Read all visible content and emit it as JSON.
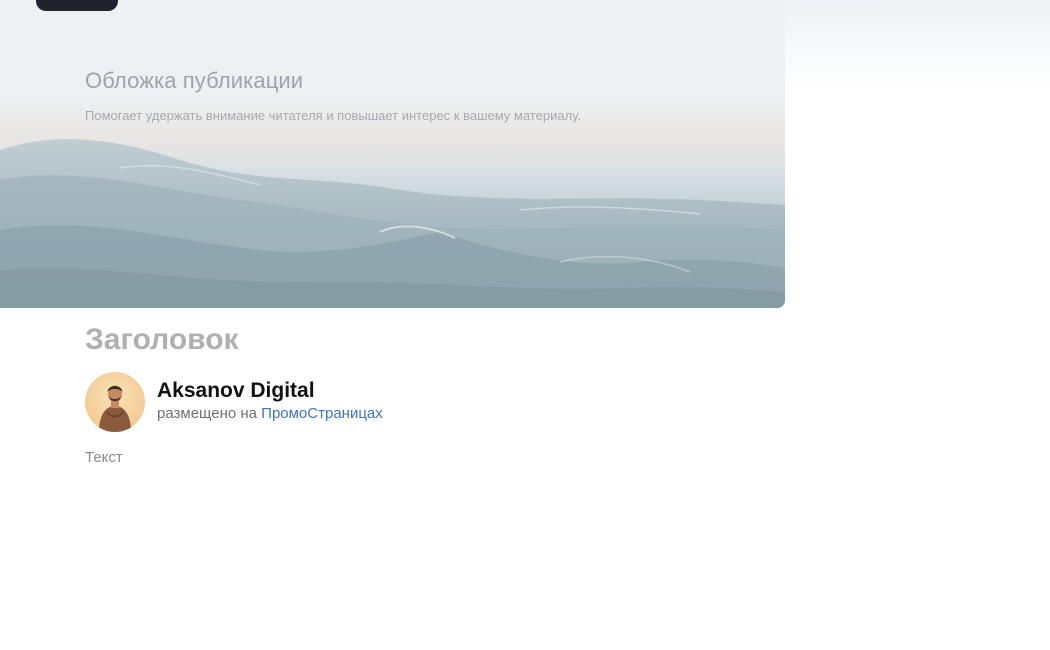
{
  "cover": {
    "title": "Обложка публикации",
    "subtitle": "Помогает удержать внимание читателя и повышает интерес к вашему материалу."
  },
  "article": {
    "title": "Заголовок",
    "body": "Текст"
  },
  "author": {
    "name": "Aksanov Digital",
    "meta_prefix": "размещено на ",
    "meta_link": "ПромоСтраницах"
  },
  "colors": {
    "link": "#3a74c4",
    "dark_pill": "#20232d"
  },
  "icons": {
    "avatar": "person-photo"
  }
}
